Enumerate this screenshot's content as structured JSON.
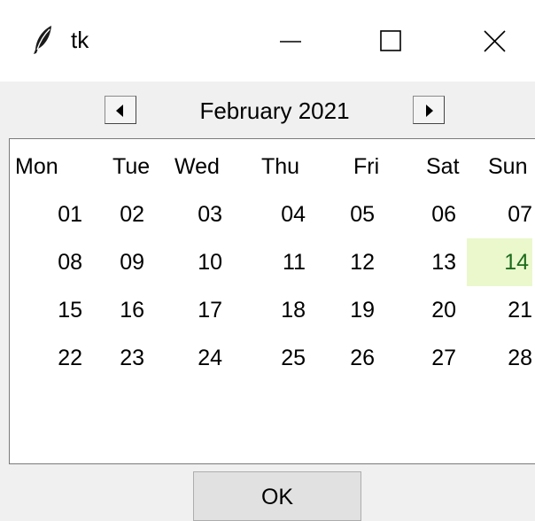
{
  "window": {
    "title": "tk",
    "controls": [
      "minimize-icon",
      "maximize-icon",
      "close-icon"
    ]
  },
  "header": {
    "month_label": "February 2021",
    "prev_icon": "triangle-left-icon",
    "next_icon": "triangle-right-icon"
  },
  "calendar": {
    "weekdays": [
      "Mon",
      "Tue",
      "Wed",
      "Thu",
      "Fri",
      "Sat",
      "Sun"
    ],
    "weeks": [
      [
        "01",
        "02",
        "03",
        "04",
        "05",
        "06",
        "07"
      ],
      [
        "08",
        "09",
        "10",
        "11",
        "12",
        "13",
        "14"
      ],
      [
        "15",
        "16",
        "17",
        "18",
        "19",
        "20",
        "21"
      ],
      [
        "22",
        "23",
        "24",
        "25",
        "26",
        "27",
        "28"
      ]
    ],
    "highlighted_day": "14",
    "highlight_color": "#eaf8cc"
  },
  "footer": {
    "ok_label": "OK"
  }
}
